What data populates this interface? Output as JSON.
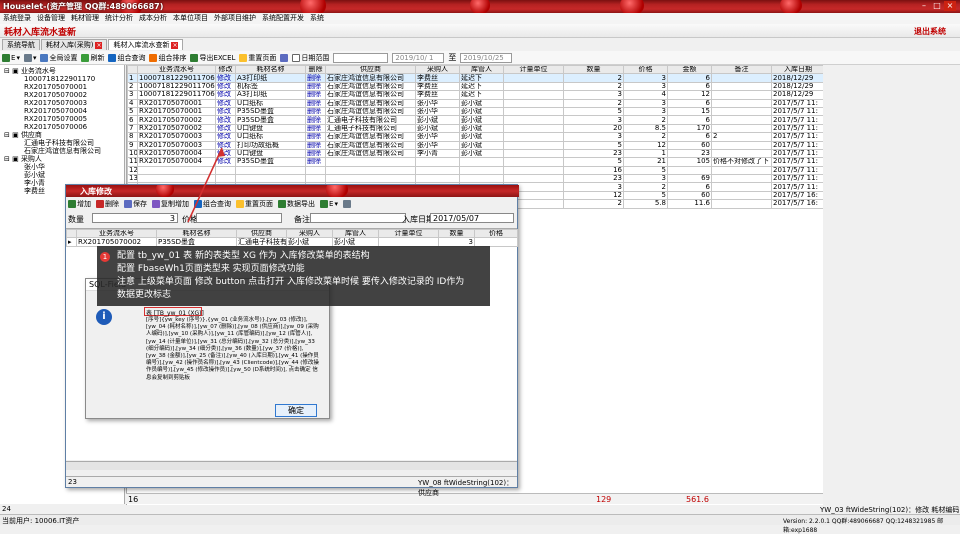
{
  "app": {
    "title": "Houselet-(资产管理 QQ群:489066687)",
    "win_min": "–",
    "win_max": "□",
    "win_close": "×"
  },
  "menu": [
    "系统登录",
    "设备管理",
    "耗材管理",
    "统计分析",
    "成本分析",
    "本单位项目",
    "外部项目维护",
    "系统配置开发",
    "系统"
  ],
  "header": {
    "title": "耗材入库流水查新",
    "exit": "退出系统"
  },
  "tabs": [
    {
      "label": "系统导航"
    },
    {
      "label": "耗材入库(采购)"
    },
    {
      "label": "耗材入库流水查新"
    }
  ],
  "toolbar": {
    "items": [
      "E",
      "",
      "全局设置",
      "刷新",
      "组合查询",
      "组合排序",
      "导出EXCEL",
      "重置页面",
      "日期范围"
    ],
    "date_from": "2019/10/ 1",
    "date_to": "2019/10/25"
  },
  "tree": {
    "roots": [
      {
        "label": "业务流水号",
        "children": [
          "1000718122901170",
          "RX201705070001",
          "RX201705070002",
          "RX201705070003",
          "RX201705070004",
          "RX201705070005",
          "RX201705070006"
        ]
      },
      {
        "label": "供应商",
        "children": [
          "汇通电子科技有限公司",
          "石家庄鸿谊信息有限公司"
        ]
      },
      {
        "label": "采购人",
        "children": [
          "张小华",
          "彭小斌",
          "李小青",
          "李费丝"
        ]
      }
    ]
  },
  "grid": {
    "columns": [
      "",
      "业务流水号",
      "修改",
      "耗材名称",
      "删除",
      "供应商",
      "采购人",
      "库管人",
      "计量单位",
      "数量",
      "价格",
      "金额",
      "备注",
      "入库日期"
    ],
    "rows": [
      [
        "1",
        "10007181229011706",
        "修改",
        "A3打印纸",
        "删除",
        "石家庄鸿谊信息有限公司",
        "李费丝",
        "延迟下",
        "",
        "2",
        "3",
        "6",
        "",
        "2018/12/29"
      ],
      [
        "2",
        "10007181229011706",
        "修改",
        "机标签",
        "删除",
        "石家庄鸿谊信息有限公司",
        "李费丝",
        "延迟下",
        "",
        "2",
        "3",
        "6",
        "",
        "2018/12/29"
      ],
      [
        "3",
        "10007181229011706",
        "修改",
        "A3打印纸",
        "删除",
        "石家庄鸿谊信息有限公司",
        "李费丝",
        "延迟下",
        "",
        "3",
        "4",
        "12",
        "",
        "2018/12/29"
      ],
      [
        "4",
        "RX201705070001",
        "修改",
        "U口纸标",
        "删除",
        "石家庄鸿谊信息有限公司",
        "张小华",
        "彭小斌",
        "",
        "2",
        "3",
        "6",
        "",
        "2017/5/7 11:"
      ],
      [
        "5",
        "RX201705070001",
        "修改",
        "P35SD墨盒",
        "删除",
        "石家庄鸿谊信息有限公司",
        "张小华",
        "彭小斌",
        "",
        "5",
        "3",
        "15",
        "",
        "2017/5/7 11:"
      ],
      [
        "6",
        "RX201705070002",
        "修改",
        "P35SD墨盒",
        "删除",
        "汇通电子科技有限公司",
        "彭小斌",
        "彭小斌",
        "",
        "3",
        "2",
        "6",
        "",
        "2017/5/7 11:"
      ],
      [
        "7",
        "RX201705070002",
        "修改",
        "U口键盘",
        "删除",
        "汇通电子科技有限公司",
        "彭小斌",
        "彭小斌",
        "",
        "20",
        "8.5",
        "170",
        "",
        "2017/5/7 11:"
      ],
      [
        "8",
        "RX201705070003",
        "修改",
        "U口纸标",
        "删除",
        "石家庄鸿谊信息有限公司",
        "张小华",
        "彭小斌",
        "",
        "3",
        "2",
        "6",
        "2",
        "2017/5/7 11:"
      ],
      [
        "9",
        "RX201705070003",
        "修改",
        "打印功故纸概",
        "删除",
        "石家庄鸿谊信息有限公司",
        "张小华",
        "彭小斌",
        "",
        "5",
        "12",
        "60",
        "",
        "2017/5/7 11:"
      ],
      [
        "10",
        "RX201705070004",
        "修改",
        "U口键盘",
        "删除",
        "石家庄鸿谊信息有限公司",
        "李小青",
        "彭小斌",
        "",
        "23",
        "1",
        "23",
        "",
        "2017/5/7 11:"
      ],
      [
        "11",
        "RX201705070004",
        "修改",
        "P35SD墨盒",
        "删除",
        "",
        "",
        "",
        "",
        "5",
        "21",
        "105",
        "价格不对修改了下",
        "2017/5/7 11:"
      ],
      [
        "12",
        "",
        "",
        "",
        "",
        "",
        "",
        "",
        "",
        "16",
        "5",
        "",
        "",
        "2017/5/7 11:"
      ],
      [
        "13",
        "",
        "",
        "",
        "",
        "",
        "",
        "",
        "",
        "23",
        "3",
        "69",
        "",
        "2017/5/7 11:"
      ],
      [
        "14",
        "",
        "",
        "",
        "",
        "",
        "",
        "",
        "",
        "3",
        "2",
        "6",
        "",
        "2017/5/7 11:"
      ],
      [
        "15",
        "",
        "",
        "",
        "",
        "",
        "",
        "",
        "",
        "12",
        "5",
        "60",
        "",
        "2017/5/7 16:"
      ],
      [
        "16",
        "",
        "",
        "",
        "",
        "",
        "",
        "",
        "",
        "2",
        "5.8",
        "11.6",
        "",
        "2017/5/7 16:"
      ]
    ],
    "footer_row": "16",
    "footer_total_qty": "129",
    "footer_total_amt": "561.6",
    "footer_hint": "YW_03 ftWideString(102)：修改 耗材编码"
  },
  "edit": {
    "title": "入库修改",
    "toolbar": [
      "增加",
      "删除",
      "保存",
      "复制增加",
      "组合查询",
      "重置页面",
      "数据导出",
      "E"
    ],
    "fields": {
      "qty_label": "数量",
      "qty_value": "3",
      "price_label": "价格",
      "note_label": "备注",
      "date_label": "入库日期",
      "date_value": "2017/05/07"
    },
    "columns": [
      "业务流水号",
      "耗材名称",
      "供应商",
      "采购人",
      "库管人",
      "计量单位",
      "数量",
      "价格"
    ],
    "row": [
      "RX201705070002",
      "P35SD墨盒",
      "汇通电子科技有",
      "彭小斌",
      "彭小斌",
      "",
      "3",
      ""
    ],
    "footer_count": "23",
    "footer_hint": "YW_08 ftWideString(102)：供应商"
  },
  "annotation": {
    "badge": "1",
    "lines": [
      "配置 tb_yw_01 表 新的表类型 XG 作为 入库修改菜单的表结构",
      "配置 FbaseWh1页面类型来 实现页面修改功能",
      "注意 上级菜单页面 修改 button 点击打开 入库修改菜单时候 要传入修改记录的 ID作为",
      "数据更改标志"
    ]
  },
  "dialog": {
    "title": "SQL-Field",
    "table_ref": "表 [TB_yw_01 (XG)]",
    "text": "[序号]{yw_key (序号)},{yw_01 (业务流水号)},[yw_03 (修改)],[yw_04 (耗材名称)],[yw_07 (删除)],[yw_08 (供应商)],[yw_09 (采购人编码)],[yw_10 (采购人)],[yw_11 (库管编码)],[yw_12 (库管人)],[yw_14 (计量单位)],[yw_31 (总分编码)],[yw_32 (总分类)],[yw_33 (细分编码)],[yw_34 (细分类)],[yw_36 (数量)],[yw_37 (价格)],[yw_38 (金额)],[yw_25 (备注)],[yw_40 (入库日期)],[yw_41 (操作员编号)],[yw_42 (操作员名称)],[yw_43 (Clientcode)],[yw_44 (修改操作员编号)],[yw_45 (修改操作员)],[yw_50 (D系统时间)], 点击确定 信息会复制到剪贴板",
    "ok": "确定"
  },
  "status": {
    "left": "24",
    "bottom_left": "当前用户: 10006.IT资产",
    "right": "Version: 2.2.0.1  QQ群:489066687  QQ:1248321985 邮箱:exp1688"
  }
}
